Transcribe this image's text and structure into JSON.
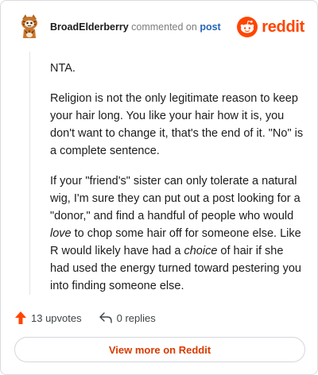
{
  "comment": {
    "author": "BroadElderberry",
    "action_text": "commented on",
    "post_link": "post",
    "avatar": "snoo-avatar-icon",
    "body": {
      "p1": "NTA.",
      "p2": "Religion is not the only legitimate reason to keep your hair long. You like your hair how it is, you don't want to change it, that's the end of it. \"No\" is a complete sentence.",
      "p3_a": "If your \"friend's\" sister can only tolerate a natural wig, I'm sure they can put out a post looking for a \"donor,\" and find a handful of people who would ",
      "p3_em1": "love",
      "p3_b": " to chop some hair off for someone else. Like R would likely have had a ",
      "p3_em2": "choice",
      "p3_c": " of hair if she had used the energy turned toward pestering you into finding someone else."
    },
    "upvotes": "13 upvotes",
    "replies": "0 replies"
  },
  "brand": {
    "name": "reddit",
    "icon": "reddit-logo-icon",
    "color": "#ff4500"
  },
  "footer": {
    "view_more_label": "View more on Reddit"
  },
  "colors": {
    "upvote": "#ff4500",
    "link": "#2466b7",
    "view_more": "#d93a00"
  }
}
